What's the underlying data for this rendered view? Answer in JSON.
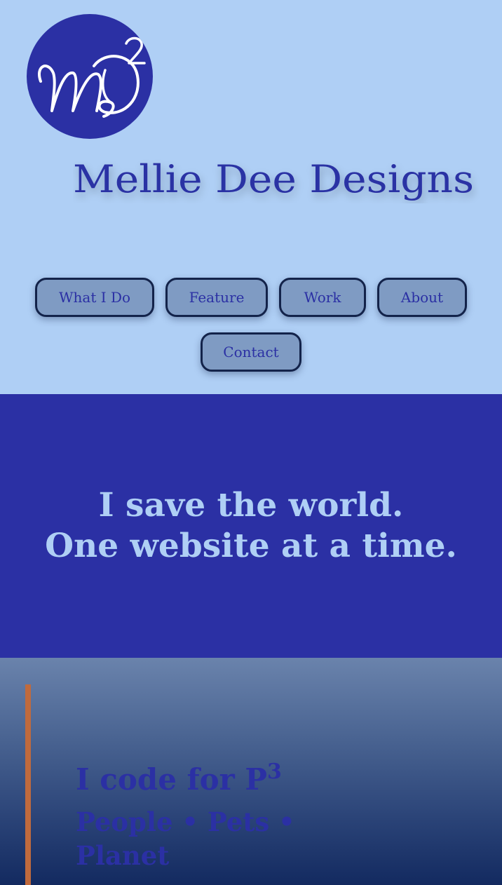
{
  "brand": {
    "logo_monogram": "MD",
    "logo_superscript": "2",
    "name": "Mellie Dee Designs"
  },
  "nav": {
    "items": [
      {
        "label": "What I Do"
      },
      {
        "label": "Feature"
      },
      {
        "label": "Work"
      },
      {
        "label": "About"
      },
      {
        "label": "Contact"
      }
    ]
  },
  "hero": {
    "line1": "I save the world.",
    "line2": "One website at a time."
  },
  "p3": {
    "heading": "I code for P",
    "heading_sup": "3",
    "subheading": "People • Pets • Planet"
  },
  "colors": {
    "page_background": "#afcff5",
    "brand_blue": "#2b30a4",
    "nav_button_fill": "#7f9bc3",
    "nav_button_border": "#13234a",
    "accent_orange": "#c06a3d"
  }
}
